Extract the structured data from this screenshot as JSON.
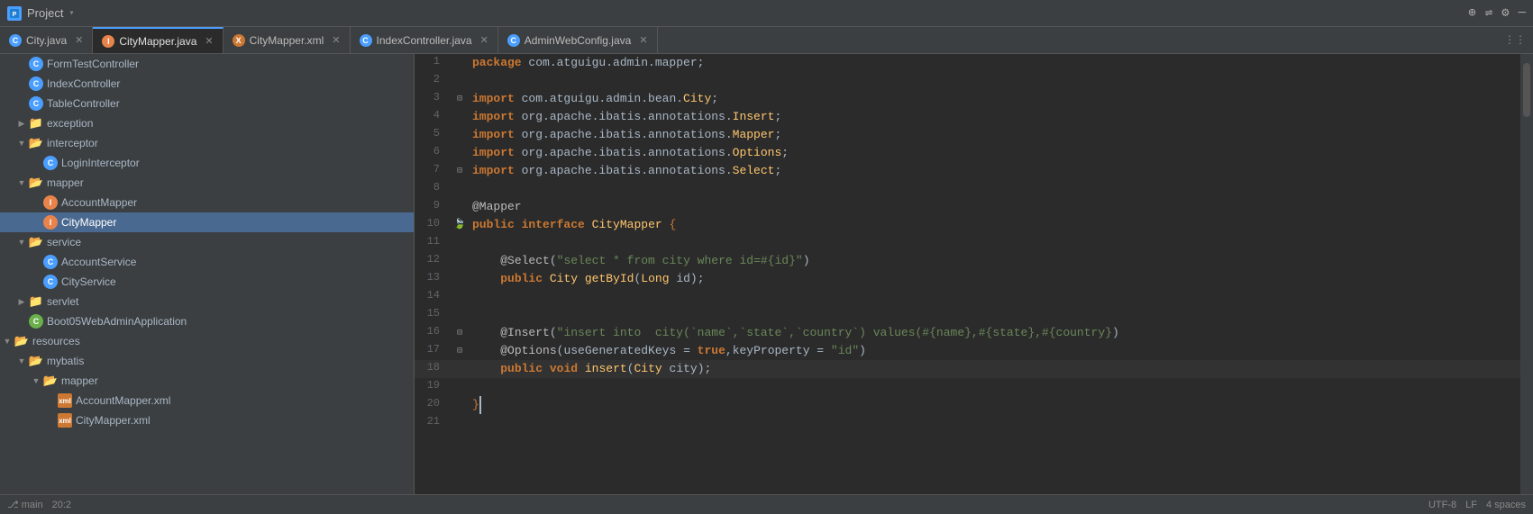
{
  "titlebar": {
    "project_label": "Project",
    "icons": [
      "⊕",
      "⇌",
      "⚙",
      "─"
    ]
  },
  "tabs": [
    {
      "id": "city-java",
      "label": "City.java",
      "icon_type": "c-blue",
      "active": false
    },
    {
      "id": "citymapper-java",
      "label": "CityMapper.java",
      "icon_type": "mapper-orange",
      "active": true
    },
    {
      "id": "citymapper-xml",
      "label": "CityMapper.xml",
      "icon_type": "xml",
      "active": false
    },
    {
      "id": "indexcontroller-java",
      "label": "IndexController.java",
      "icon_type": "c-blue",
      "active": false
    },
    {
      "id": "adminwebconfig-java",
      "label": "AdminWebConfig.java",
      "icon_type": "c-blue",
      "active": false
    }
  ],
  "sidebar": {
    "items": [
      {
        "indent": 0,
        "type": "file",
        "icon": "C",
        "icon_color": "blue",
        "label": "FormTestController",
        "selected": false
      },
      {
        "indent": 0,
        "type": "file",
        "icon": "C",
        "icon_color": "blue",
        "label": "IndexController",
        "selected": false
      },
      {
        "indent": 0,
        "type": "file",
        "icon": "C",
        "icon_color": "blue",
        "label": "TableController",
        "selected": false
      },
      {
        "indent": 0,
        "type": "folder",
        "open": false,
        "label": "exception",
        "selected": false
      },
      {
        "indent": 0,
        "type": "folder",
        "open": true,
        "label": "interceptor",
        "selected": false
      },
      {
        "indent": 1,
        "type": "file",
        "icon": "C",
        "icon_color": "blue",
        "label": "LoginInterceptor",
        "selected": false
      },
      {
        "indent": 0,
        "type": "folder",
        "open": true,
        "label": "mapper",
        "selected": false
      },
      {
        "indent": 1,
        "type": "file",
        "icon": "I",
        "icon_color": "orange",
        "label": "AccountMapper",
        "selected": false
      },
      {
        "indent": 1,
        "type": "file",
        "icon": "I",
        "icon_color": "orange",
        "label": "CityMapper",
        "selected": true
      },
      {
        "indent": 0,
        "type": "folder",
        "open": true,
        "label": "service",
        "selected": false
      },
      {
        "indent": 1,
        "type": "file",
        "icon": "C",
        "icon_color": "blue",
        "label": "AccountService",
        "selected": false
      },
      {
        "indent": 1,
        "type": "file",
        "icon": "C",
        "icon_color": "blue",
        "label": "CityService",
        "selected": false
      },
      {
        "indent": 0,
        "type": "folder",
        "open": false,
        "label": "servlet",
        "selected": false
      },
      {
        "indent": 0,
        "type": "file",
        "icon": "C",
        "icon_color": "spring",
        "label": "Boot05WebAdminApplication",
        "selected": false
      },
      {
        "indent": 0,
        "type": "folder",
        "open": true,
        "label": "resources",
        "selected": false
      },
      {
        "indent": 1,
        "type": "folder",
        "open": true,
        "label": "mybatis",
        "selected": false
      },
      {
        "indent": 2,
        "type": "folder",
        "open": true,
        "label": "mapper",
        "selected": false
      },
      {
        "indent": 3,
        "type": "file",
        "icon": "xml",
        "icon_color": "xml",
        "label": "AccountMapper.xml",
        "selected": false
      },
      {
        "indent": 3,
        "type": "file",
        "icon": "xml",
        "icon_color": "xml",
        "label": "CityMapper.xml",
        "selected": false
      }
    ]
  },
  "code": {
    "lines": [
      {
        "num": 1,
        "content": "package com.atguigu.admin.mapper;",
        "tokens": [
          {
            "t": "kw",
            "v": "package"
          },
          {
            "t": "plain",
            "v": " com.atguigu.admin.mapper;"
          }
        ]
      },
      {
        "num": 2,
        "content": "",
        "tokens": []
      },
      {
        "num": 3,
        "content": "import com.atguigu.admin.bean.City;",
        "tokens": [
          {
            "t": "kw",
            "v": "import"
          },
          {
            "t": "plain",
            "v": " com.atguigu.admin.bean."
          },
          {
            "t": "cls",
            "v": "City"
          },
          {
            "t": "plain",
            "v": ";"
          }
        ],
        "fold": true
      },
      {
        "num": 4,
        "content": "import org.apache.ibatis.annotations.Insert;",
        "tokens": [
          {
            "t": "kw",
            "v": "import"
          },
          {
            "t": "plain",
            "v": " org.apache.ibatis.annotations."
          },
          {
            "t": "cls",
            "v": "Insert"
          },
          {
            "t": "plain",
            "v": ";"
          }
        ]
      },
      {
        "num": 5,
        "content": "import org.apache.ibatis.annotations.Mapper;",
        "tokens": [
          {
            "t": "kw",
            "v": "import"
          },
          {
            "t": "plain",
            "v": " org.apache.ibatis.annotations."
          },
          {
            "t": "cls",
            "v": "Mapper"
          },
          {
            "t": "plain",
            "v": ";"
          }
        ]
      },
      {
        "num": 6,
        "content": "import org.apache.ibatis.annotations.Options;",
        "tokens": [
          {
            "t": "kw",
            "v": "import"
          },
          {
            "t": "plain",
            "v": " org.apache.ibatis.annotations."
          },
          {
            "t": "cls",
            "v": "Options"
          },
          {
            "t": "plain",
            "v": ";"
          }
        ]
      },
      {
        "num": 7,
        "content": "import org.apache.ibatis.annotations.Select;",
        "tokens": [
          {
            "t": "kw",
            "v": "import"
          },
          {
            "t": "plain",
            "v": " org.apache.ibatis.annotations."
          },
          {
            "t": "cls",
            "v": "Select"
          },
          {
            "t": "plain",
            "v": ";"
          }
        ],
        "fold": true
      },
      {
        "num": 8,
        "content": "",
        "tokens": []
      },
      {
        "num": 9,
        "content": "@Mapper",
        "tokens": [
          {
            "t": "ann",
            "v": "@Mapper"
          }
        ]
      },
      {
        "num": 10,
        "content": "public interface CityMapper {",
        "tokens": [
          {
            "t": "kw",
            "v": "public"
          },
          {
            "t": "plain",
            "v": " "
          },
          {
            "t": "kw",
            "v": "interface"
          },
          {
            "t": "plain",
            "v": " "
          },
          {
            "t": "cls",
            "v": "CityMapper"
          },
          {
            "t": "plain",
            "v": " {"
          }
        ],
        "gutter_icon": true
      },
      {
        "num": 11,
        "content": "",
        "tokens": []
      },
      {
        "num": 12,
        "content": "    @Select(\"select * from city where id=#{id}\")",
        "tokens": [
          {
            "t": "ann",
            "v": "    @Select"
          },
          {
            "t": "plain",
            "v": "("
          },
          {
            "t": "str",
            "v": "\"select * from city where id=#{id}\""
          },
          {
            "t": "plain",
            "v": ")"
          }
        ]
      },
      {
        "num": 13,
        "content": "    public City getById(Long id);",
        "tokens": [
          {
            "t": "plain",
            "v": "    "
          },
          {
            "t": "kw",
            "v": "public"
          },
          {
            "t": "plain",
            "v": " "
          },
          {
            "t": "cls",
            "v": "City"
          },
          {
            "t": "plain",
            "v": " "
          },
          {
            "t": "method",
            "v": "getById"
          },
          {
            "t": "plain",
            "v": "("
          },
          {
            "t": "cls",
            "v": "Long"
          },
          {
            "t": "plain",
            "v": " id);"
          }
        ]
      },
      {
        "num": 14,
        "content": "",
        "tokens": []
      },
      {
        "num": 15,
        "content": "",
        "tokens": []
      },
      {
        "num": 16,
        "content": "    @Insert(\"insert into  city(`name`,`state`,`country`) values(#{name},#{state},#{country})",
        "tokens": [
          {
            "t": "ann",
            "v": "    @Insert"
          },
          {
            "t": "plain",
            "v": "("
          },
          {
            "t": "str",
            "v": "\"insert into  city(`name`,`state`,`country`) values(#{name},#{state},#{country})"
          }
        ],
        "fold": true
      },
      {
        "num": 17,
        "content": "    @Options(useGeneratedKeys = true,keyProperty = \"id\")",
        "tokens": [
          {
            "t": "ann",
            "v": "    @Options"
          },
          {
            "t": "plain",
            "v": "(useGeneratedKeys = "
          },
          {
            "t": "kw",
            "v": "true"
          },
          {
            "t": "plain",
            "v": ",keyProperty = "
          },
          {
            "t": "str",
            "v": "\"id\""
          },
          {
            "t": "plain",
            "v": ")"
          }
        ],
        "fold": true
      },
      {
        "num": 18,
        "content": "    public void insert(City city);",
        "tokens": [
          {
            "t": "plain",
            "v": "    "
          },
          {
            "t": "kw",
            "v": "public"
          },
          {
            "t": "plain",
            "v": " "
          },
          {
            "t": "kw",
            "v": "void"
          },
          {
            "t": "plain",
            "v": " "
          },
          {
            "t": "method",
            "v": "insert"
          },
          {
            "t": "plain",
            "v": "("
          },
          {
            "t": "cls",
            "v": "City"
          },
          {
            "t": "plain",
            "v": " city);"
          }
        ]
      },
      {
        "num": 19,
        "content": "",
        "tokens": []
      },
      {
        "num": 20,
        "content": "}",
        "tokens": [
          {
            "t": "brace",
            "v": "}"
          }
        ]
      },
      {
        "num": 21,
        "content": "",
        "tokens": []
      }
    ]
  },
  "statusbar": {
    "encoding": "UTF-8",
    "line_sep": "LF",
    "indent": "4 spaces",
    "position": "20:2",
    "git": "main"
  }
}
